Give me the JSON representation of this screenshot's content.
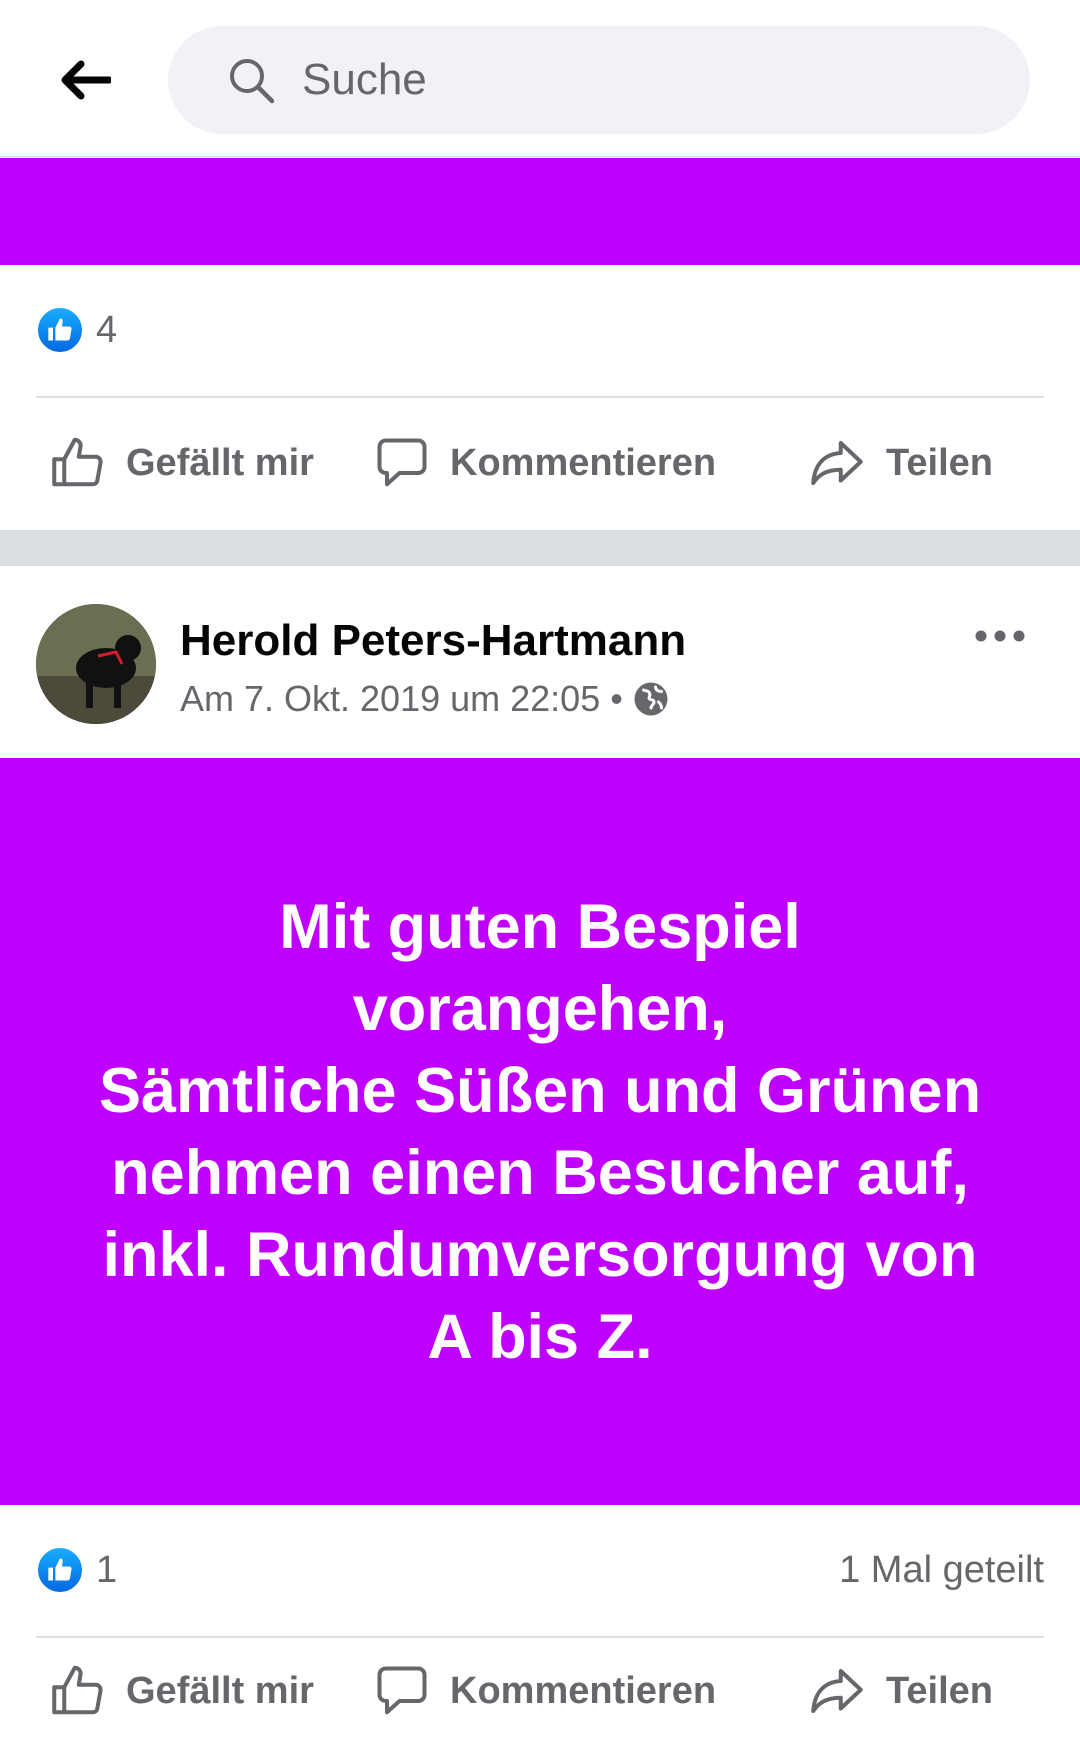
{
  "search": {
    "placeholder": "Suche"
  },
  "icons": {
    "back": "arrow-left-icon",
    "search": "search-icon",
    "like": "thumbs-up-icon",
    "comment": "comment-icon",
    "share": "share-icon",
    "more": "more-icon",
    "privacy": "globe-icon"
  },
  "colors": {
    "post_background": "#c000ff",
    "like_blue": "#0866ff",
    "muted_text": "#65676b"
  },
  "previous_post": {
    "reaction_count": "4",
    "actions": {
      "like": "Gefällt mir",
      "comment": "Kommentieren",
      "share": "Teilen"
    }
  },
  "post": {
    "author": "Herold Peters-Hartmann",
    "timestamp": "Am 7. Okt. 2019 um 22:05",
    "separator": "•",
    "text": "Mit guten Bespiel\nvorangehen,\nSämtliche Süßen und Grünen\nnehmen einen Besucher auf,\ninkl. Rundumversorgung von\nA bis Z.",
    "reaction_count": "1",
    "shares": "1 Mal geteilt",
    "actions": {
      "like": "Gefällt mir",
      "comment": "Kommentieren",
      "share": "Teilen"
    }
  }
}
